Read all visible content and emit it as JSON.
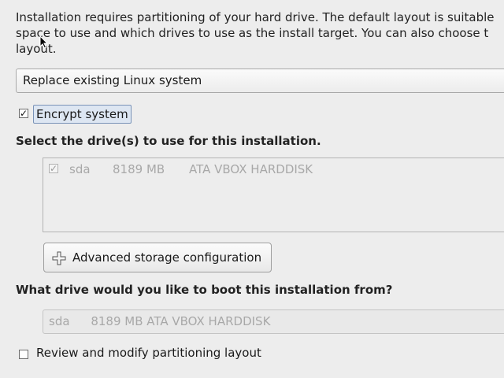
{
  "intro": {
    "line1": "Installation requires partitioning of your hard drive.  The default layout is suitable",
    "line2": "space to use and which drives to use as the install target. You can also choose t",
    "line3": "layout."
  },
  "partition_mode": {
    "selected": "Replace existing Linux system"
  },
  "encrypt": {
    "label": "Encrypt system",
    "checked": true
  },
  "drives_heading": "Select the drive(s) to use for this installation.",
  "drives": [
    {
      "name": "sda",
      "size": "8189 MB",
      "model": "ATA VBOX HARDDISK",
      "checked": true
    }
  ],
  "advanced_button": {
    "label": "Advanced storage configuration"
  },
  "boot_heading": "What drive would you like to boot this installation from?",
  "boot_drive": {
    "name": "sda",
    "detail": "8189 MB ATA VBOX HARDDISK"
  },
  "review": {
    "label": "Review and modify partitioning layout",
    "checked": false
  },
  "icons": [
    "plus-icon",
    "mouse-pointer-icon",
    "checkmark-icon"
  ]
}
